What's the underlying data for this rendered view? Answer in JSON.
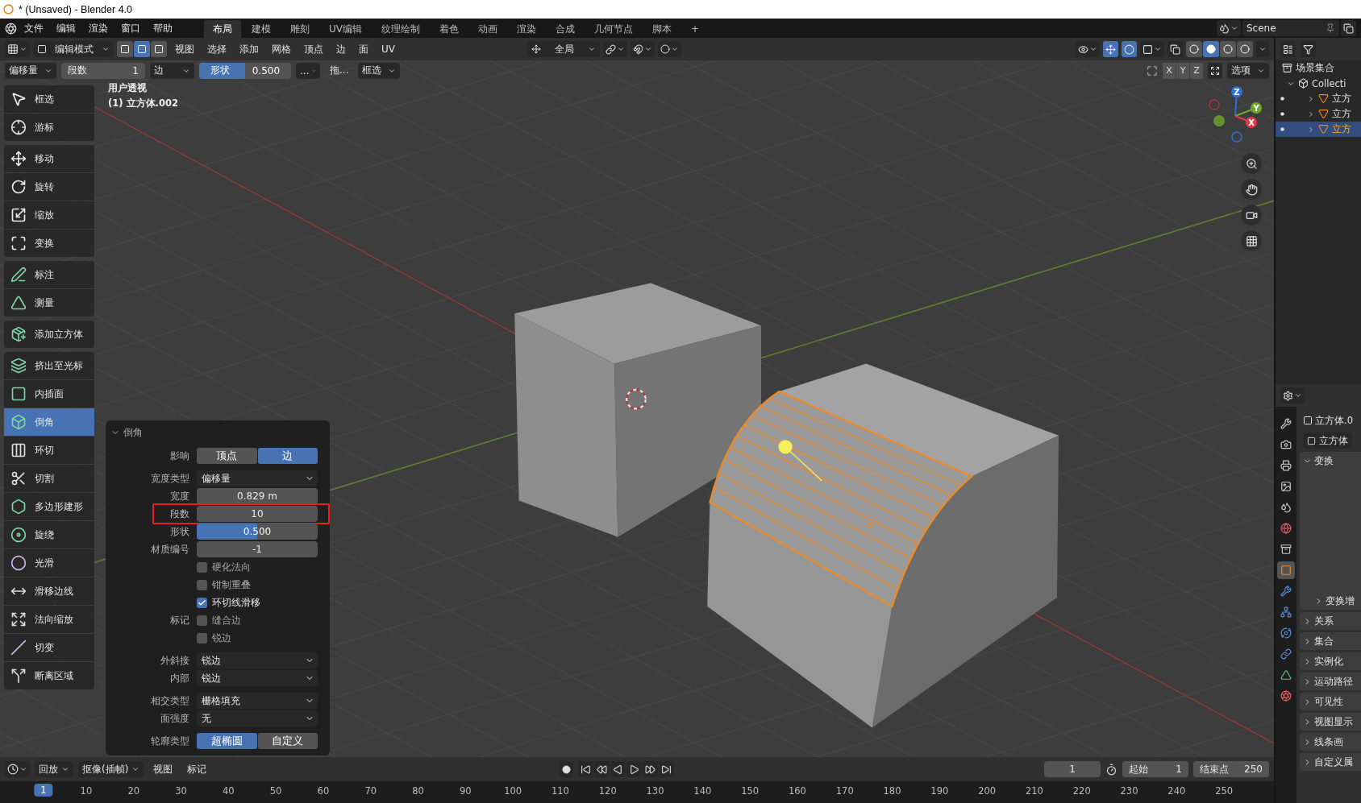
{
  "title_bar": {
    "title": "* (Unsaved) - Blender 4.0"
  },
  "menu_bar": {
    "menus": [
      "文件",
      "编辑",
      "渲染",
      "窗口",
      "帮助"
    ],
    "workspaces": [
      {
        "label": "布局",
        "selected": true
      },
      {
        "label": "建模",
        "selected": false
      },
      {
        "label": "雕刻",
        "selected": false
      },
      {
        "label": "UV编辑",
        "selected": false
      },
      {
        "label": "纹理绘制",
        "selected": false
      },
      {
        "label": "着色",
        "selected": false
      },
      {
        "label": "动画",
        "selected": false
      },
      {
        "label": "渲染",
        "selected": false
      },
      {
        "label": "合成",
        "selected": false
      },
      {
        "label": "几何节点",
        "selected": false
      },
      {
        "label": "脚本",
        "selected": false
      }
    ],
    "add_workspace": "+",
    "scene": "Scene"
  },
  "header": {
    "mode": "编辑模式",
    "select_modes": [
      {
        "selected": false
      },
      {
        "selected": true
      },
      {
        "selected": false
      }
    ],
    "menus": [
      "视图",
      "选择",
      "添加",
      "网格",
      "顶点",
      "边",
      "面",
      "UV"
    ],
    "orientation": "全局",
    "shading_modes": [
      {
        "selected": false
      },
      {
        "selected": true
      },
      {
        "selected": false
      },
      {
        "selected": false
      }
    ]
  },
  "tool_settings": {
    "width_type": "偏移量",
    "segments": {
      "label": "段数",
      "value": "1"
    },
    "affect": "边",
    "shape": {
      "label": "形状",
      "value": "0.500",
      "level": 0.5
    },
    "more": "...",
    "drag": "拖...",
    "select": "框选",
    "axes": [
      "X",
      "Y",
      "Z"
    ],
    "options": "选项"
  },
  "viewport": {
    "view_name": "用户透视",
    "object_name": "(1) 立方体.002",
    "gizmo_axes": [
      "Z",
      "Y",
      "X"
    ]
  },
  "toolbar": {
    "groups": [
      {
        "tools": [
          {
            "label": "框选",
            "selected": false
          },
          {
            "label": "游标",
            "selected": false
          }
        ]
      },
      {
        "tools": [
          {
            "label": "移动",
            "selected": false
          },
          {
            "label": "旋转",
            "selected": false
          },
          {
            "label": "缩放",
            "selected": false
          },
          {
            "label": "变换",
            "selected": false
          }
        ]
      },
      {
        "tools": [
          {
            "label": "标注",
            "selected": false
          },
          {
            "label": "测量",
            "selected": false
          }
        ]
      },
      {
        "tools": [
          {
            "label": "添加立方体",
            "selected": false
          }
        ]
      },
      {
        "tools": [
          {
            "label": "挤出至光标",
            "selected": false
          },
          {
            "label": "内插面",
            "selected": false
          },
          {
            "label": "倒角",
            "selected": true
          },
          {
            "label": "环切",
            "selected": false
          },
          {
            "label": "切割",
            "selected": false
          },
          {
            "label": "多边形建形",
            "selected": false
          },
          {
            "label": "旋绕",
            "selected": false
          },
          {
            "label": "光滑",
            "selected": false
          },
          {
            "label": "滑移边线",
            "selected": false
          },
          {
            "label": "法向缩放",
            "selected": false
          },
          {
            "label": "切变",
            "selected": false
          },
          {
            "label": "断离区域",
            "selected": false
          }
        ]
      }
    ]
  },
  "bevel_panel": {
    "title": "倒角",
    "sections": [
      [
        {
          "kind": "segmented",
          "label": "影响",
          "options": [
            {
              "label": "顶点",
              "selected": false
            },
            {
              "label": "边",
              "selected": true
            }
          ]
        }
      ],
      [
        {
          "kind": "dropdown",
          "label": "宽度类型",
          "value": "偏移量"
        },
        {
          "kind": "number",
          "label": "宽度",
          "value": "0.829 m",
          "highlighted": false
        },
        {
          "kind": "number",
          "label": "段数",
          "value": "10",
          "highlighted": true
        },
        {
          "kind": "slider",
          "label": "形状",
          "value": "0.500",
          "level": 0.5
        },
        {
          "kind": "number",
          "label": "材质编号",
          "value": "-1",
          "highlighted": false
        },
        {
          "kind": "checkbox",
          "text": "硬化法向",
          "checked": false
        },
        {
          "kind": "checkbox",
          "text": "钳制重叠",
          "checked": false
        },
        {
          "kind": "checkbox",
          "text": "环切线滑移",
          "checked": true
        },
        {
          "kind": "checkbox",
          "label": "标记",
          "text": "缝合边",
          "checked": false
        },
        {
          "kind": "checkbox",
          "text": "锐边",
          "checked": false
        }
      ],
      [
        {
          "kind": "dropdown",
          "label": "外斜接",
          "value": "锐边"
        },
        {
          "kind": "dropdown",
          "label": "内部",
          "value": "锐边"
        }
      ],
      [
        {
          "kind": "dropdown",
          "label": "相交类型",
          "value": "栅格填充"
        },
        {
          "kind": "dropdown",
          "label": "面强度",
          "value": "无"
        }
      ],
      [
        {
          "kind": "segmented",
          "label": "轮廓类型",
          "options": [
            {
              "label": "超椭圆",
              "selected": true
            },
            {
              "label": "自定义",
              "selected": false
            }
          ]
        }
      ]
    ]
  },
  "outliner": {
    "root": "场景集合",
    "collection": "Collecti",
    "objects": [
      {
        "name": "立方",
        "selected": false
      },
      {
        "name": "立方",
        "selected": false
      },
      {
        "name": "立方",
        "selected": true
      }
    ]
  },
  "properties": {
    "tabs": [
      {
        "selected": false
      },
      {
        "selected": false
      },
      {
        "selected": false
      },
      {
        "selected": false
      },
      {
        "selected": false
      },
      {
        "selected": false
      },
      {
        "selected": false
      },
      {
        "selected": true
      },
      {
        "selected": false
      },
      {
        "selected": false
      },
      {
        "selected": false
      },
      {
        "selected": false
      },
      {
        "selected": false
      },
      {
        "selected": false
      }
    ],
    "object_name": "立方体.0",
    "data_name": "立方体",
    "panels": [
      {
        "title": "变换",
        "expanded": true,
        "children": [
          {
            "title": "变换增",
            "expanded": false
          }
        ]
      },
      {
        "title": "关系",
        "expanded": false
      },
      {
        "title": "集合",
        "expanded": false
      },
      {
        "title": "实例化",
        "expanded": false
      },
      {
        "title": "运动路径",
        "expanded": false
      },
      {
        "title": "可见性",
        "expanded": false
      },
      {
        "title": "视图显示",
        "expanded": false
      },
      {
        "title": "线条画",
        "expanded": false
      },
      {
        "title": "自定义属",
        "expanded": false
      }
    ]
  },
  "timeline": {
    "editor_menus": [
      "回放",
      "抠像(插帧)"
    ],
    "menus": [
      "视图",
      "标记"
    ],
    "current_frame": "1",
    "start_label": "起始",
    "start": "1",
    "end_label": "结束点",
    "end": "250",
    "ruler": {
      "current": "1",
      "ticks": [
        "10",
        "20",
        "30",
        "40",
        "50",
        "60",
        "70",
        "80",
        "90",
        "100",
        "110",
        "120",
        "130",
        "140",
        "150",
        "160",
        "170",
        "180",
        "190",
        "200",
        "210",
        "220",
        "230",
        "240",
        "250"
      ]
    }
  }
}
